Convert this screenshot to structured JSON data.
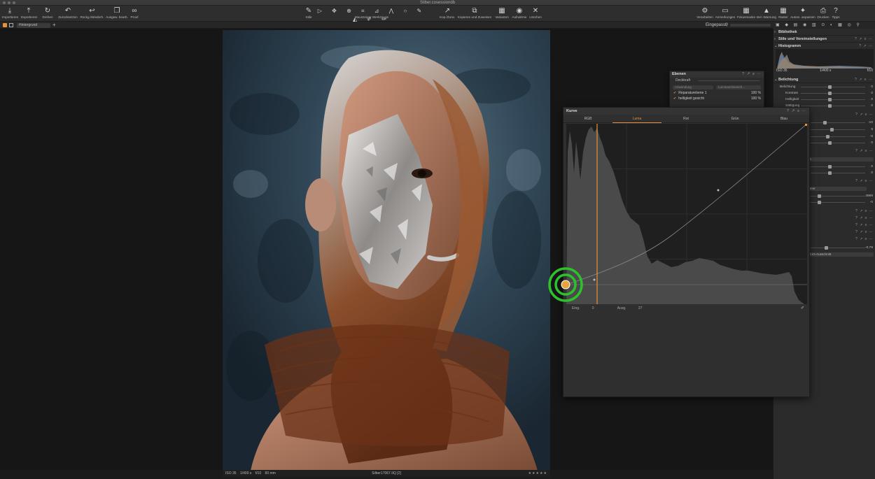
{
  "window": {
    "title": "Silber.cosessiondb"
  },
  "toolbar": {
    "left": [
      {
        "label": "Importieren",
        "icon": "⤓"
      },
      {
        "label": "Exportieren",
        "icon": "⤒"
      },
      {
        "label": "Drehen",
        "icon": "↻"
      },
      {
        "label": "Zurücksetzen",
        "icon": "↶"
      },
      {
        "label": "Rückg./Wiederh.",
        "icon": "↩"
      },
      {
        "label": "Ausgew. bearb.",
        "icon": "❐"
      },
      {
        "label": "Proof",
        "icon": "∞"
      }
    ],
    "center_left": [
      {
        "label": "Stile",
        "icon": "✎"
      }
    ],
    "cursor_tools_label": "Mauszeiger Werkzeuge",
    "center_right": [
      {
        "label": "Kop./Zurw.",
        "icon": "↗"
      },
      {
        "label": "Kopieren und Zuweisen",
        "icon": "⧉"
      },
      {
        "label": "Varianten",
        "icon": "▦"
      },
      {
        "label": "Aufnahme",
        "icon": "◉"
      },
      {
        "label": "Löschen",
        "icon": "✕"
      }
    ],
    "right": [
      {
        "label": "Verarbeiten",
        "icon": "⚙"
      },
      {
        "label": "Anmerkungen",
        "icon": "▭"
      },
      {
        "label": "Fokusmaske",
        "icon": "▦"
      },
      {
        "label": "Bel.-Warnung",
        "icon": "▲"
      },
      {
        "label": "Raster",
        "icon": "▦"
      },
      {
        "label": "Autom. anpassen",
        "icon": "✦"
      },
      {
        "label": "Drucken",
        "icon": "⎙"
      },
      {
        "label": "Tipps",
        "icon": "?"
      }
    ]
  },
  "subbar": {
    "layer_select": "Hintergrund",
    "fit_label": "Eingepasst"
  },
  "viewer": {
    "status": {
      "iso": "ISO 35",
      "shutter": "1/400 s",
      "aperture": "f/10",
      "focal": "60 mm",
      "filename": "Silber17067.IIQ [2]",
      "stars": "★★★★★"
    }
  },
  "right_panel": {
    "sections": [
      {
        "title": "Bibliothek"
      },
      {
        "title": "Stile und Voreinstellungen"
      },
      {
        "title": "Histogramm"
      }
    ],
    "histogram_info": {
      "iso": "ISO 35",
      "shutter": "1/400 s",
      "aperture": "f/10"
    },
    "exposure": {
      "title": "Belichtung",
      "rows": [
        {
          "name": "Belichtung",
          "value": "0",
          "pos": 0.5
        },
        {
          "name": "Kontrast",
          "value": "0",
          "pos": 0.5
        },
        {
          "name": "Helligkeit",
          "value": "0",
          "pos": 0.5
        },
        {
          "name": "Sättigung",
          "value": "0",
          "pos": 0.5
        }
      ]
    },
    "more_values": [
      "-10",
      "9",
      "-8",
      "0",
      "0",
      "0",
      "4999",
      "-0",
      "-0,78"
    ],
    "dropdowns": [
      "ich",
      "ahme",
      "ich im Ausschnitt"
    ]
  },
  "layers_panel": {
    "title": "Ebenen",
    "opacity_label": "Deckkraft",
    "pill_left": "Anwendung",
    "pill_right": "Luminanzbereich...",
    "layers": [
      {
        "name": "Reparaturebene 1",
        "opacity": "100 %"
      },
      {
        "name": "helligkeit gesicht",
        "opacity": "100 %"
      }
    ]
  },
  "curve_panel": {
    "title": "Kurve",
    "tabs": [
      "RGB",
      "Luma",
      "Rot",
      "Grün",
      "Blau"
    ],
    "active_tab": "Luma",
    "input_label": "Eing.",
    "input_value": "0",
    "output_label": "Ausg.",
    "output_value": "27"
  },
  "colors": {
    "accent": "#e8913a",
    "click": "#2dc12d"
  }
}
